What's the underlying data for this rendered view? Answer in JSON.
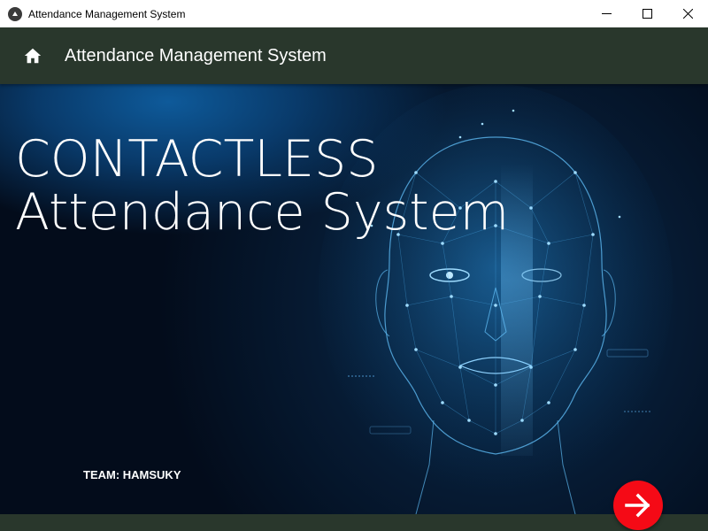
{
  "window": {
    "title": "Attendance Management System",
    "controls": [
      "minimize",
      "maximize",
      "close"
    ]
  },
  "toolbar": {
    "title": "Attendance Management System",
    "left_icon": "home-icon"
  },
  "hero": {
    "headline_line1": "CONTACTLESS",
    "headline_line2": "Attendance System",
    "team_label": "TEAM: HAMSUKY"
  },
  "fab": {
    "icon": "arrow-right-icon",
    "color": "#f50a16"
  },
  "colors": {
    "toolbar_bg": "#29372c",
    "hero_bg": "#061a32",
    "accent": "#f50a16"
  }
}
